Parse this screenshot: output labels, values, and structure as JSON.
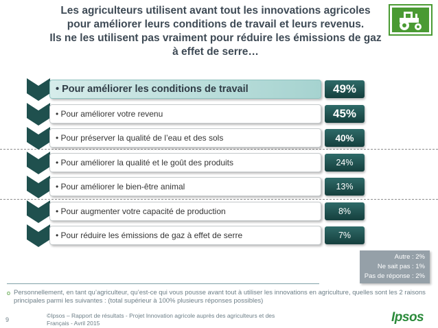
{
  "title": {
    "line1": "Les agriculteurs utilisent avant tout les innovations agricoles",
    "line2": "pour améliorer leurs conditions de travail et leurs revenus.",
    "line3": "Ils ne les utilisent pas vraiment pour réduire les émissions de gaz",
    "line4": "à effet de serre…"
  },
  "icon": "tractor-icon",
  "colors": {
    "bar": "#1f504e",
    "highlight": "#a6d3d0",
    "accent": "#4a9a33",
    "other_box": "#95a0a8"
  },
  "chart_data": {
    "type": "bar",
    "orientation": "horizontal",
    "categories": [
      "Pour améliorer les conditions de travail",
      "Pour améliorer votre revenu",
      "Pour préserver la qualité de l’eau et des sols",
      "Pour améliorer la qualité et le goût des produits",
      "Pour améliorer le bien-être animal",
      "Pour augmenter votre capacité de production",
      "Pour réduire les émissions de gaz à effet de serre"
    ],
    "values": [
      49,
      45,
      40,
      24,
      13,
      8,
      7
    ],
    "value_labels": [
      "49%",
      "45%",
      "40%",
      "24%",
      "13%",
      "8%",
      "7%"
    ],
    "highlighted_category": "Pour améliorer les conditions de travail",
    "other_answers": [
      "Autre : 2%",
      "Ne sait pas : 1%",
      "Pas de réponse : 2%"
    ]
  },
  "note": "Personnellement, en tant qu’agriculteur, qu’est-ce qui vous pousse avant tout à utiliser les innovations en agriculture, quelles sont les 2 raisons principales parmi les suivantes : (total supérieur à 100% plusieurs réponses possibles)",
  "footer": {
    "page": "9",
    "line1": "©Ipsos – Rapport de résultats - Projet Innovation agricole auprès des agriculteurs et des",
    "line2": "Français - Avril 2015",
    "logo": "Ipsos"
  }
}
